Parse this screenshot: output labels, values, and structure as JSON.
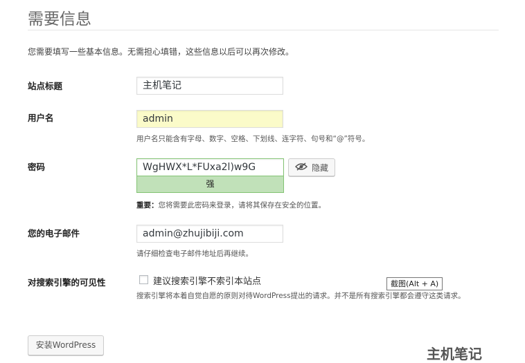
{
  "page": {
    "heading": "需要信息",
    "intro": "您需要填写一些基本信息。无需担心填错，这些信息以后可以再次修改。"
  },
  "site_title": {
    "label": "站点标题",
    "value": "主机笔记"
  },
  "username": {
    "label": "用户名",
    "value": "admin",
    "help": "用户名只能含有字母、数字、空格、下划线、连字符、句号和“@”符号。"
  },
  "password": {
    "label": "密码",
    "value": "WgHWX*L*FUxa2l)w9G",
    "hide_label": "隐藏",
    "strength": "强",
    "help_strong": "重要：",
    "help": "您将需要此密码来登录，请将其保存在安全的位置。"
  },
  "email": {
    "label": "您的电子邮件",
    "value": "admin@zhujibiji.com",
    "help": "请仔细检查电子邮件地址后再继续。"
  },
  "search_visibility": {
    "label": "对搜索引擎的可见性",
    "checkbox_label": "建议搜索引擎不索引本站点",
    "checked": false,
    "help": "搜索引擎将本着自觉自愿的原则对待WordPress提出的请求。并不是所有搜索引擎都会遵守这类请求。"
  },
  "tooltip": "截图(Alt + A)",
  "install_button": "安装WordPress",
  "watermark": "主机笔记",
  "icons": {
    "hide": "eye-slash-icon"
  },
  "colors": {
    "strength_bg": "#c1e1b9",
    "strength_border": "#83c373",
    "autofill_bg": "#fbfbc9"
  }
}
